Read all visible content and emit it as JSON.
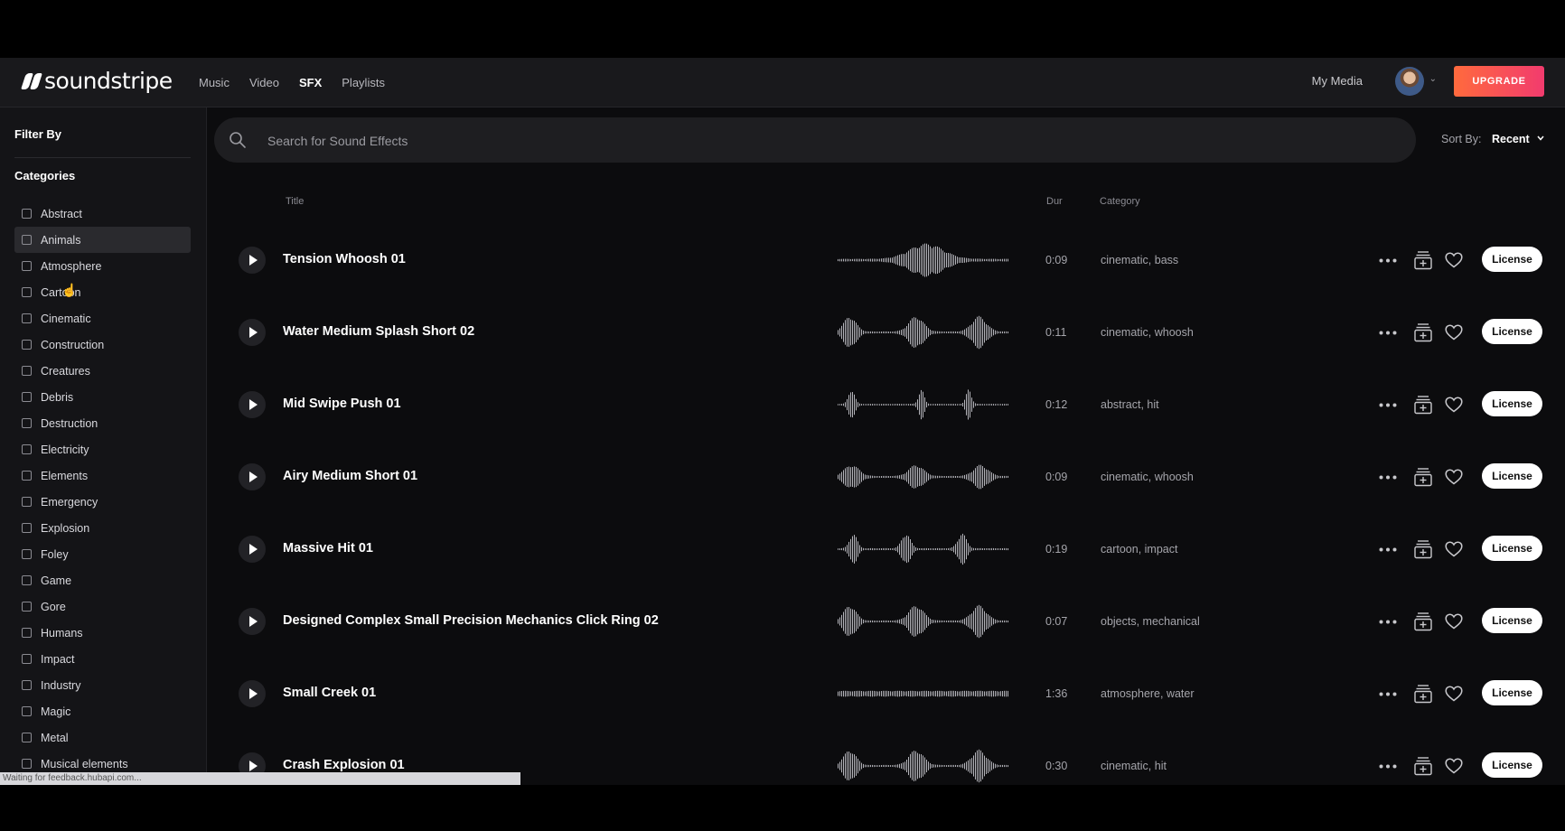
{
  "brand": {
    "name": "soundstripe"
  },
  "nav": {
    "links": [
      {
        "label": "Music"
      },
      {
        "label": "Video"
      },
      {
        "label": "SFX",
        "active": true
      },
      {
        "label": "Playlists"
      }
    ],
    "my_media": "My Media",
    "upgrade": "UPGRADE"
  },
  "sidebar": {
    "filter_by": "Filter By",
    "categories_heading": "Categories",
    "categories": [
      {
        "label": "Abstract"
      },
      {
        "label": "Animals",
        "hovered": true
      },
      {
        "label": "Atmosphere"
      },
      {
        "label": "Cartoon"
      },
      {
        "label": "Cinematic"
      },
      {
        "label": "Construction"
      },
      {
        "label": "Creatures"
      },
      {
        "label": "Debris"
      },
      {
        "label": "Destruction"
      },
      {
        "label": "Electricity"
      },
      {
        "label": "Elements"
      },
      {
        "label": "Emergency"
      },
      {
        "label": "Explosion"
      },
      {
        "label": "Foley"
      },
      {
        "label": "Game"
      },
      {
        "label": "Gore"
      },
      {
        "label": "Humans"
      },
      {
        "label": "Impact"
      },
      {
        "label": "Industry"
      },
      {
        "label": "Magic"
      },
      {
        "label": "Metal"
      },
      {
        "label": "Musical elements"
      }
    ]
  },
  "search": {
    "placeholder": "Search for Sound Effects",
    "value": ""
  },
  "sort": {
    "label": "Sort By:",
    "value": "Recent"
  },
  "columns": {
    "title": "Title",
    "duration": "Dur",
    "category": "Category"
  },
  "tracks": [
    {
      "title": "Tension Whoosh 01",
      "duration": "0:09",
      "categories": "cinematic, bass",
      "waveform": "swell"
    },
    {
      "title": "Water Medium Splash Short 02",
      "duration": "0:11",
      "categories": "cinematic, whoosh",
      "waveform": "three-bursts"
    },
    {
      "title": "Mid Swipe Push 01",
      "duration": "0:12",
      "categories": "abstract, hit",
      "waveform": "three-spikes"
    },
    {
      "title": "Airy Medium Short 01",
      "duration": "0:09",
      "categories": "cinematic, whoosh",
      "waveform": "three-soft"
    },
    {
      "title": "Massive Hit 01",
      "duration": "0:19",
      "categories": "cartoon, impact",
      "waveform": "three-hits"
    },
    {
      "title": "Designed Complex Small Precision Mechanics Click Ring 02",
      "duration": "0:07",
      "categories": "objects, mechanical",
      "waveform": "three-bursts"
    },
    {
      "title": "Small Creek 01",
      "duration": "1:36",
      "categories": "atmosphere, water",
      "waveform": "flat"
    },
    {
      "title": "Crash Explosion 01",
      "duration": "0:30",
      "categories": "cinematic, hit",
      "waveform": "three-bursts"
    }
  ],
  "track_actions": {
    "license": "License"
  },
  "status": {
    "text": "Waiting for feedback.hubapi.com..."
  },
  "colors": {
    "upgrade_from": "#ff6a3d",
    "upgrade_to": "#f23b6e",
    "background": "#0c0c0e"
  }
}
